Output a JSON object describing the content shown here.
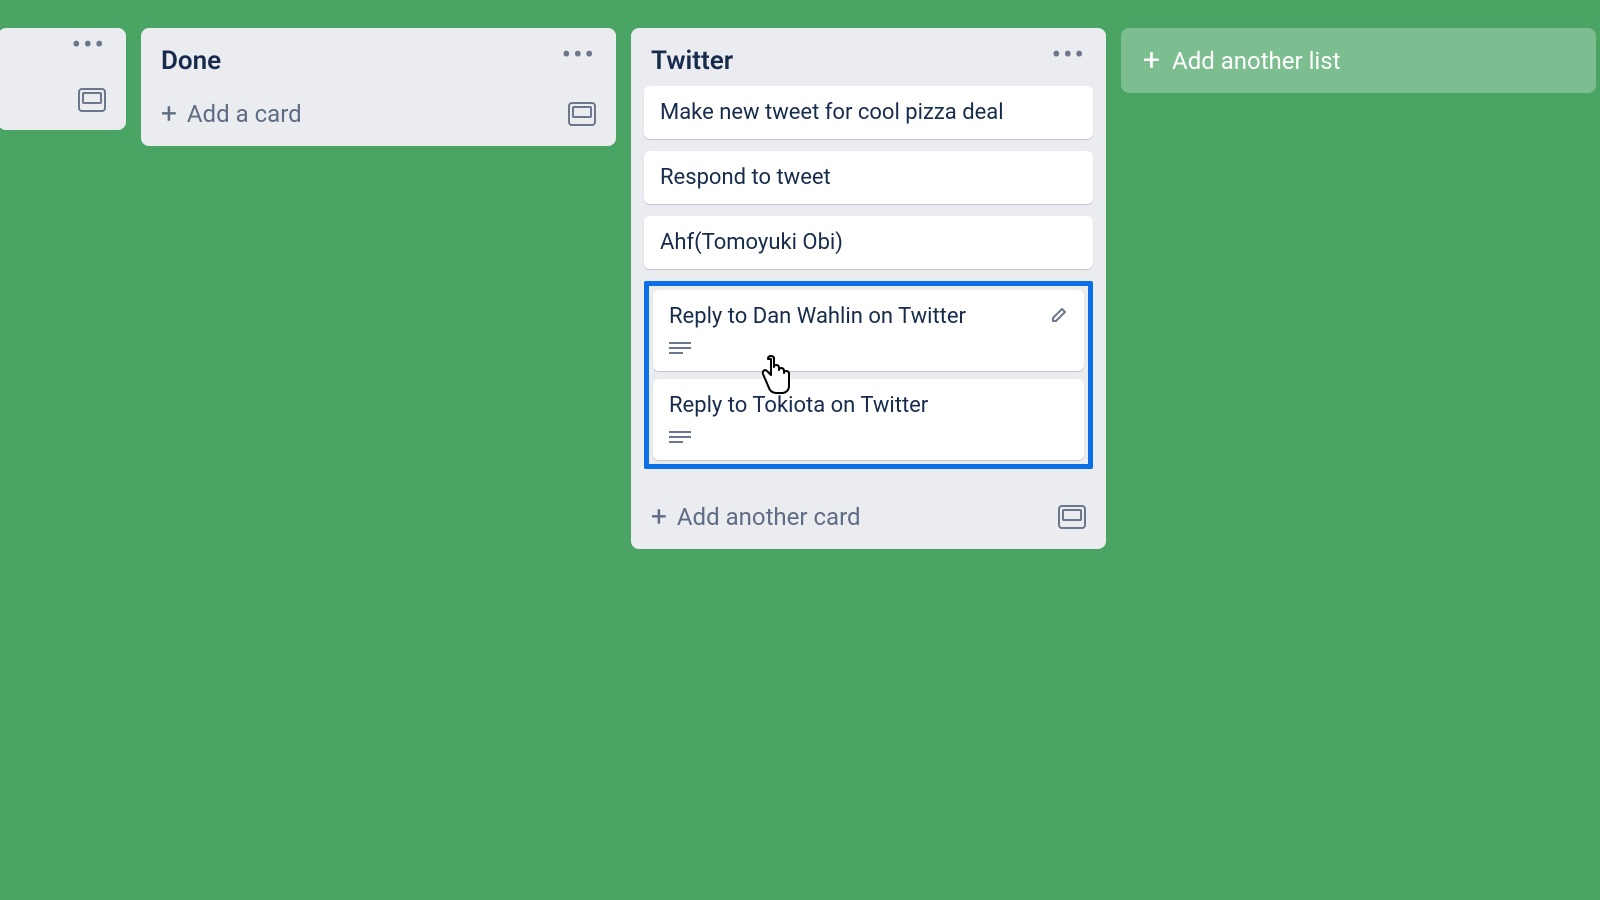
{
  "colors": {
    "board_bg": "#4aa564",
    "highlight": "#0a6fe8"
  },
  "lists": {
    "partial": {
      "title": ""
    },
    "done": {
      "title": "Done",
      "add_card_label": "Add a card"
    },
    "twitter": {
      "title": "Twitter",
      "cards": [
        {
          "title": "Make new tweet for cool pizza deal"
        },
        {
          "title": "Respond to tweet"
        },
        {
          "title": "Ahf(Tomoyuki Obi)"
        }
      ],
      "highlighted_cards": [
        {
          "title": "Reply to Dan Wahlin on Twitter",
          "has_description": true,
          "hovered": true
        },
        {
          "title": "Reply to Tokiota on Twitter",
          "has_description": true
        }
      ],
      "add_card_label": "Add another card"
    }
  },
  "add_list_label": "Add another list"
}
